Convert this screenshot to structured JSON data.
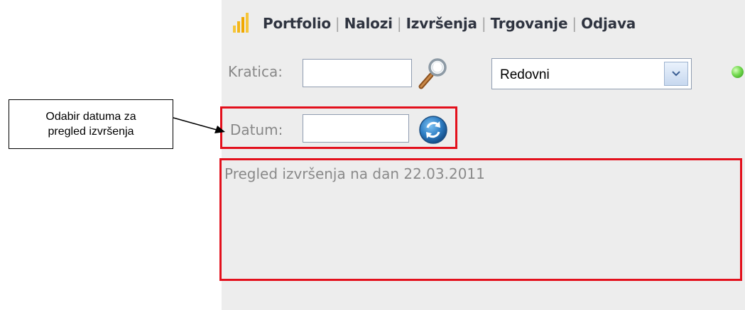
{
  "nav": {
    "items": [
      {
        "label": "Portfolio"
      },
      {
        "label": "Nalozi"
      },
      {
        "label": "Izvršenja"
      },
      {
        "label": "Trgovanje"
      },
      {
        "label": "Odjava"
      }
    ],
    "separator": "|",
    "logo_icon": "bar-chart-logo-icon"
  },
  "form": {
    "kratica_label": "Kratica:",
    "kratica_value": "",
    "search_icon": "magnifier-icon",
    "order_type": {
      "selected": "Redovni",
      "icon": "chevron-down-icon"
    },
    "status_icon": "status-green-dot-icon",
    "datum_label": "Datum:",
    "datum_value": "",
    "refresh_icon": "refresh-icon"
  },
  "executions": {
    "summary": "Pregled izvršenja na dan 22.03.2011"
  },
  "annotation": {
    "line1": "Odabir datuma za",
    "line2": "pregled izvršenja"
  },
  "colors": {
    "panel_bg": "#ededed",
    "highlight_border": "#e3101c",
    "nav_text": "#2f3440",
    "status_green": "#5cc83a"
  }
}
